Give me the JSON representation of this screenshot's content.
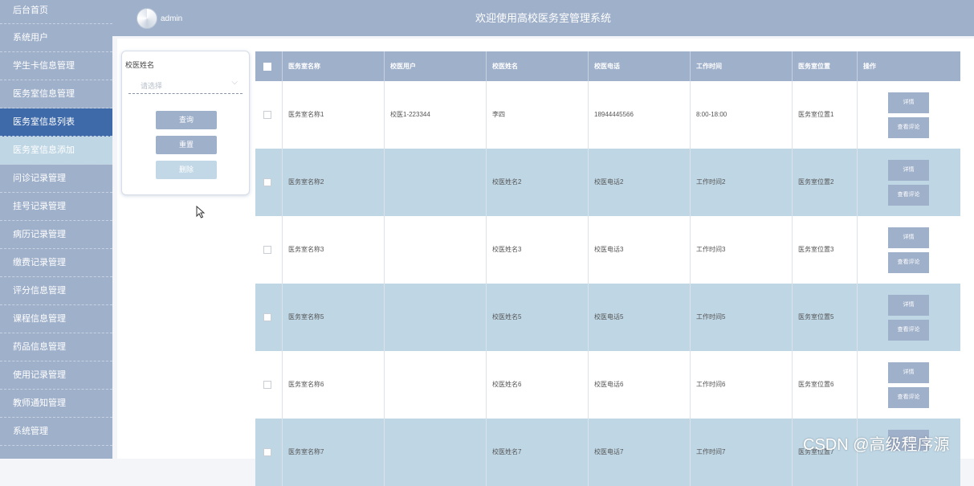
{
  "sidebar": {
    "items": [
      {
        "label": "后台首页"
      },
      {
        "label": "系统用户"
      },
      {
        "label": "学生卡信息管理"
      },
      {
        "label": "医务室信息管理"
      },
      {
        "label": "医务室信息列表"
      },
      {
        "label": "医务室信息添加"
      },
      {
        "label": "问诊记录管理"
      },
      {
        "label": "挂号记录管理"
      },
      {
        "label": "病历记录管理"
      },
      {
        "label": "缴费记录管理"
      },
      {
        "label": "评分信息管理"
      },
      {
        "label": "课程信息管理"
      },
      {
        "label": "药品信息管理"
      },
      {
        "label": "使用记录管理"
      },
      {
        "label": "教师通知管理"
      },
      {
        "label": "系统管理"
      }
    ]
  },
  "header": {
    "username": "admin",
    "title": "欢迎使用高校医务室管理系统"
  },
  "filter": {
    "label": "校医姓名",
    "placeholder": "请选择",
    "query_label": "查询",
    "reset_label": "重置",
    "delete_label": "删除"
  },
  "table": {
    "columns": [
      "医务室名称",
      "校医用户",
      "校医姓名",
      "校医电话",
      "工作时间",
      "医务室位置",
      "操作"
    ],
    "detail_label": "详情",
    "review_label": "查看评论",
    "rows": [
      {
        "name": "医务室名称1",
        "user": "校医1-223344",
        "doctor": "李四",
        "phone": "18944445566",
        "hours": "8:00-18:00",
        "location": "医务室位置1"
      },
      {
        "name": "医务室名称2",
        "user": "",
        "doctor": "校医姓名2",
        "phone": "校医电话2",
        "hours": "工作时间2",
        "location": "医务室位置2"
      },
      {
        "name": "医务室名称3",
        "user": "",
        "doctor": "校医姓名3",
        "phone": "校医电话3",
        "hours": "工作时间3",
        "location": "医务室位置3"
      },
      {
        "name": "医务室名称5",
        "user": "",
        "doctor": "校医姓名5",
        "phone": "校医电话5",
        "hours": "工作时间5",
        "location": "医务室位置5"
      },
      {
        "name": "医务室名称6",
        "user": "",
        "doctor": "校医姓名6",
        "phone": "校医电话6",
        "hours": "工作时间6",
        "location": "医务室位置6"
      },
      {
        "name": "医务室名称7",
        "user": "",
        "doctor": "校医姓名7",
        "phone": "校医电话7",
        "hours": "工作时间7",
        "location": "医务室位置7"
      }
    ]
  },
  "watermark": "CSDN @高级程序源"
}
